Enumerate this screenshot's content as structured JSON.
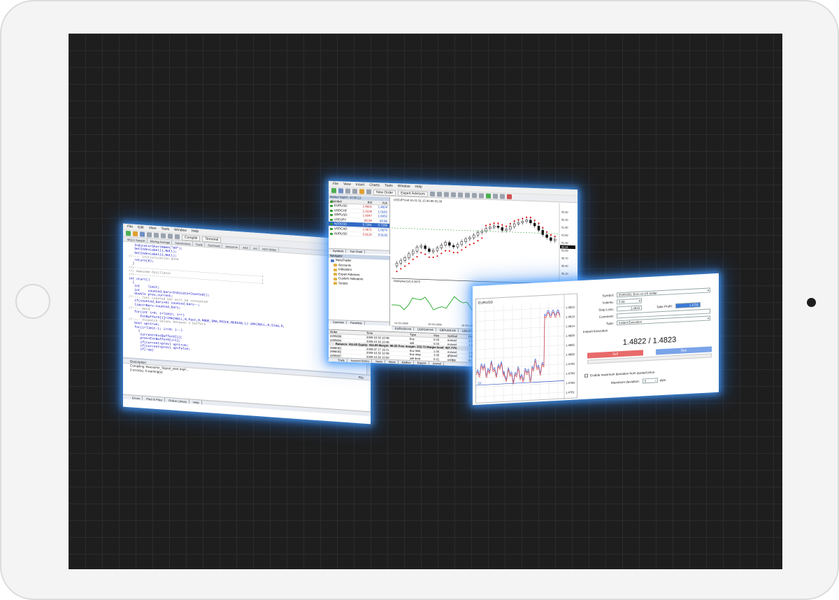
{
  "editor": {
    "menu": [
      "File",
      "Edit",
      "View",
      "Tools",
      "Window",
      "Help"
    ],
    "toolbar": {
      "compile": "Compile",
      "terminal": "Terminal"
    },
    "tabs": [
      "MQL5 Sample",
      "Moving Average",
      "Subwindows",
      "Trade",
      "Stochastic",
      "Awesome",
      "ADX",
      "AO",
      "ADX Wilder"
    ],
    "code_lines": [
      {
        "t": "   IndicatorShortName(\"AO\");",
        "cls": "k"
      },
      {
        "t": "   SetIndexLabel(1,NULL);",
        "cls": "k"
      },
      {
        "t": "   SetIndexLabel(2,NULL);",
        "cls": "k"
      },
      {
        "t": "//---- initialization done",
        "cls": "c"
      },
      {
        "t": "   return(0);",
        "cls": "k"
      },
      {
        "t": "  }",
        "cls": ""
      },
      {
        "t": "//+------------------------------------------------------------------+",
        "cls": "c"
      },
      {
        "t": "//| Awesome Oscillator                                               |",
        "cls": "c"
      },
      {
        "t": "//+------------------------------------------------------------------+",
        "cls": "c"
      },
      {
        "t": "int start()",
        "cls": "k"
      },
      {
        "t": "  {",
        "cls": ""
      },
      {
        "t": "   int    limit;",
        "cls": "k"
      },
      {
        "t": "   int    counted_bars=IndicatorCounted();",
        "cls": "k"
      },
      {
        "t": "   double prev,current;",
        "cls": "k"
      },
      {
        "t": "//---- last counted bar will be recounted",
        "cls": "c"
      },
      {
        "t": "   if(counted_bars>0) counted_bars--;",
        "cls": "k"
      },
      {
        "t": "   limit=Bars-counted_bars;",
        "cls": "k"
      },
      {
        "t": "//---- macd",
        "cls": "c"
      },
      {
        "t": "   for(int i=0; i<limit; i++)",
        "cls": "k"
      },
      {
        "t": "      ExtBuffer0[i]=iMA(NULL,0,Fast,0,MODE_SMA,PRICE_MEDIAN,i)-iMA(NULL,0,Slow,0,",
        "cls": "k"
      },
      {
        "t": "//---- dispatch values between 2 buffers",
        "cls": "c"
      },
      {
        "t": "   bool up=true;",
        "cls": "k"
      },
      {
        "t": "   for(i=limit-1; i>=0; i--)",
        "cls": "k"
      },
      {
        "t": "     {",
        "cls": ""
      },
      {
        "t": "      current=ExtBuffer0[i];",
        "cls": "k"
      },
      {
        "t": "      prev=ExtBuffer0[i+1];",
        "cls": "k"
      },
      {
        "t": "      if(current>prev) up=true;",
        "cls": "k"
      },
      {
        "t": "      if(current<prev) up=false;",
        "cls": "k"
      },
      {
        "t": "      if(!up)",
        "cls": "k"
      }
    ],
    "errors": {
      "col_description": "Description",
      "col_file": "File",
      "line1": "Compiling 'Awesome_Signal_start.mq4'...",
      "line2": "0 error(s), 0 warning(s)"
    },
    "bottom_tabs": [
      "Errors",
      "Find in Files",
      "Online Library",
      "Help"
    ]
  },
  "terminal": {
    "menu": [
      "File",
      "View",
      "Insert",
      "Charts",
      "Tools",
      "Window",
      "Help"
    ],
    "toolbar": {
      "new_order": "New Order",
      "expert_advisors": "Expert Advisors"
    },
    "market_watch": {
      "title": "Market Watch: 10:30:13",
      "col_symbol": "Symbol",
      "col_bid": "Bid",
      "col_ask": "Ask",
      "rows": [
        {
          "symbol": "EURUSD",
          "bid": "1.4821",
          "ask": "1.4824",
          "sel": false
        },
        {
          "symbol": "USDCHF",
          "bid": "1.0109",
          "ask": "1.0162",
          "sel": false
        },
        {
          "symbol": "GBPUSD",
          "bid": "1.6047",
          "ask": "1.6052",
          "sel": false
        },
        {
          "symbol": "USDJPY",
          "bid": "90.94",
          "ask": "90.96",
          "sel": false
        },
        {
          "symbol": "NZDUSD",
          "bid": "0.7261",
          "ask": "0.7268",
          "sel": true
        },
        {
          "symbol": "USDCAD",
          "bid": "1.0671",
          "ask": "1.0674",
          "sel": false
        },
        {
          "symbol": "AUDUSD",
          "bid": "0.9132",
          "ask": "0.9136",
          "sel": false
        }
      ],
      "tabs": [
        "Symbols",
        "Tick Chart"
      ]
    },
    "navigator": {
      "title": "Navigator",
      "items": [
        "MetaTrader",
        "Accounts",
        "Indicators",
        "Expert Advisors",
        "Custom Indicators",
        "Scripts"
      ],
      "tabs": [
        "Common",
        "Favorites"
      ]
    },
    "chart": {
      "title": "USDJPY,H4  91.01 91.15 90.89 91.09",
      "price_labels": [
        "92.50",
        "92.20",
        "91.90",
        "91.60",
        "91.30",
        "91.00",
        "90.70",
        "90.40",
        "90.10"
      ],
      "current_price": "90.94",
      "date_labels": [
        "14 Oct 2009",
        "16 Oct 2009",
        "19 Oct 2009",
        "21 Oct 2009",
        "26 Oct 2009"
      ],
      "tabs": [
        "EURUSD,H4",
        "USDCHF,H4",
        "GBPUSD,H4",
        "USDJPY,H4"
      ],
      "osc_label": "DeMarker(14) 0.3975"
    },
    "orders": {
      "headers": [
        "Order",
        "Time",
        "Type",
        "Size",
        "Symbol",
        "Price"
      ],
      "rows": [
        [
          "4295698",
          "2009.10.30 10:48",
          "buy",
          "0.03",
          "eurusd",
          "1.4823"
        ],
        [
          "4295694",
          "2009.10.30 10:48",
          "sell",
          "0.03",
          "eurusd",
          "1.4823"
        ]
      ],
      "balance": "Balance: 411.63  Equity: 412.05  Margin: 96.32  Free margin: 315.73  Margin level: 427.77%",
      "rows2": [
        [
          "2896062",
          "2009.07.17 16:11",
          "buy limit",
          "1.00",
          "eurusd",
          "1.4077"
        ],
        [
          "2896082",
          "2009.10.30 10:49",
          "buy stop",
          "1.00",
          "gbpusd",
          "1.6500"
        ],
        [
          "4295697",
          "2009.10.30 10:50",
          "sell limit",
          "0.01",
          "usdjpy",
          "91.24"
        ]
      ],
      "tabs": [
        "Trade",
        "Account History",
        "News",
        "Alerts",
        "Mailbox",
        "Experts",
        "Journal"
      ]
    }
  },
  "order_window": {
    "chart_title": "EURUSD",
    "price_labels": [
      "1.4823",
      "1.4819",
      "1.4814",
      "1.4809",
      "1.4805",
      "1.4800",
      "1.4795",
      "1.4790",
      "1.4786",
      "1.4781"
    ],
    "tp_label": "TP",
    "symbol_label": "Symbol:",
    "symbol_value": "EURUSD, Euro vs US Dollar",
    "volume_label": "Volume:",
    "volume_value": "0.03",
    "stoploss_label": "Stop Loss:",
    "stoploss_value": "1.4815",
    "takeprofit_label": "Take Profit:",
    "takeprofit_value": "1.4790",
    "comment_label": "Comment:",
    "comment_value": "",
    "type_label": "Type:",
    "type_value": "Instant Execution",
    "section": "Instant Execution",
    "quote": "1.4822 / 1.4823",
    "sell": "Sell",
    "buy": "Buy",
    "deviation_check": "Enable maximum deviation from quoted price",
    "max_dev_label": "Maximum deviation:",
    "max_dev_value": "0",
    "max_dev_unit": "pips"
  }
}
